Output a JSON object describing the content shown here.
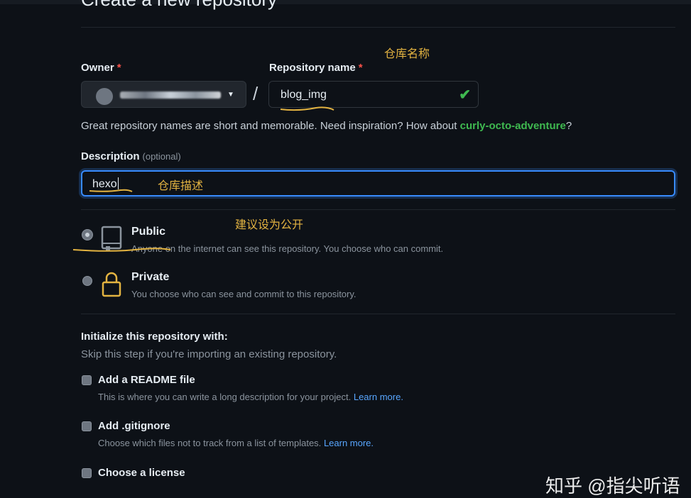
{
  "page": {
    "title": "Create a new repository"
  },
  "owner": {
    "label": "Owner",
    "required_mark": "*"
  },
  "repo_name": {
    "label": "Repository name",
    "required_mark": "*",
    "value": "blog_img",
    "check_icon": "check-icon"
  },
  "separator": "/",
  "hint": {
    "text": "Great repository names are short and memorable. Need inspiration? How about ",
    "suggestion": "curly-octo-adventure",
    "end": "?"
  },
  "description": {
    "label": "Description",
    "optional": "(optional)",
    "value": "hexo"
  },
  "visibility": {
    "public": {
      "title": "Public",
      "desc": "Anyone on the internet can see this repository. You choose who can commit.",
      "selected": true,
      "icon": "repo-icon"
    },
    "private": {
      "title": "Private",
      "desc": "You choose who can see and commit to this repository.",
      "selected": false,
      "icon": "lock-icon"
    }
  },
  "init": {
    "title": "Initialize this repository with:",
    "subtitle": "Skip this step if you're importing an existing repository.",
    "options": [
      {
        "title": "Add a README file",
        "desc": "This is where you can write a long description for your project.",
        "link": "Learn more."
      },
      {
        "title": "Add .gitignore",
        "desc": "Choose which files not to track from a list of templates.",
        "link": "Learn more."
      },
      {
        "title": "Choose a license",
        "desc": "",
        "link": ""
      }
    ]
  },
  "annotations": {
    "repo_name": "仓库名称",
    "description": "仓库描述",
    "visibility": "建议设为公开"
  },
  "watermark": "知乎 @指尖听语",
  "colors": {
    "background": "#0d1117",
    "accent_green": "#3fb950",
    "link": "#58a6ff",
    "focus": "#388bfd",
    "annotation": "#e3b341",
    "required": "#f85149"
  }
}
